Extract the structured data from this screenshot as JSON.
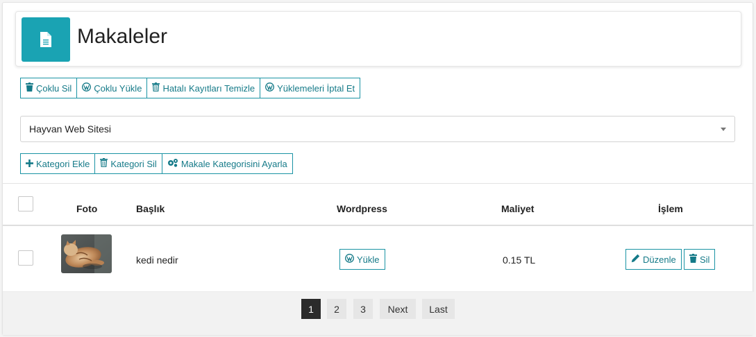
{
  "header": {
    "title": "Makaleler",
    "icon": "document-icon",
    "accent": "#1aa3b3"
  },
  "toolbar1": {
    "bulk_delete": "Çoklu Sil",
    "bulk_upload": "Çoklu Yükle",
    "clear_errors": "Hatalı Kayıtları Temizle",
    "cancel_uploads": "Yüklemeleri İptal Et"
  },
  "site_select": {
    "value": "Hayvan Web Sitesi"
  },
  "toolbar2": {
    "add_category": "Kategori Ekle",
    "delete_category": "Kategori Sil",
    "set_category": "Makale Kategorisini Ayarla"
  },
  "table": {
    "columns": {
      "photo": "Foto",
      "title": "Başlık",
      "wordpress": "Wordpress",
      "cost": "Maliyet",
      "action": "İşlem"
    },
    "rows": [
      {
        "title": "kedi nedir",
        "upload_label": "Yükle",
        "cost": "0.15 TL",
        "edit_label": "Düzenle",
        "delete_label": "Sil"
      }
    ]
  },
  "pagination": {
    "pages": [
      "1",
      "2",
      "3"
    ],
    "current": "1",
    "next": "Next",
    "last": "Last"
  },
  "colors": {
    "button_border": "#1a93a4",
    "button_text": "#157a88",
    "active_page": "#2b2b2b"
  }
}
